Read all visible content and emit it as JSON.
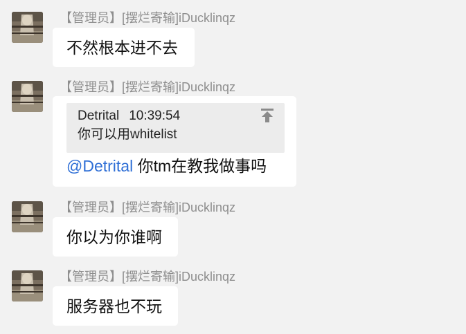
{
  "messages": [
    {
      "sender": "【管理员】[摆烂寄输]iDucklinqz",
      "text": "不然根本进不去"
    },
    {
      "sender": "【管理员】[摆烂寄输]iDucklinqz",
      "quote": {
        "author": "Detrital",
        "time": "10:39:54",
        "text": "你可以用whitelist",
        "icon": "jump-to-top-icon"
      },
      "mention": "@Detrital",
      "text": " 你tm在教我做事吗"
    },
    {
      "sender": "【管理员】[摆烂寄输]iDucklinqz",
      "text": "你以为你谁啊"
    },
    {
      "sender": "【管理员】[摆烂寄输]iDucklinqz",
      "text": "服务器也不玩"
    }
  ],
  "colors": {
    "background": "#f2f2f2",
    "bubble": "#ffffff",
    "quote_background": "#ececec",
    "sender": "#8e8e8e",
    "mention": "#2f6fd6"
  }
}
